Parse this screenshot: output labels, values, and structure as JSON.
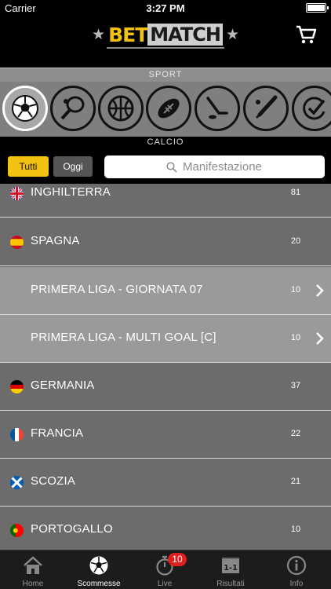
{
  "status_bar": {
    "carrier": "Carrier",
    "time": "3:27 PM"
  },
  "header": {
    "logo_bet": "BET",
    "logo_match": "MATCH",
    "cart_icon": "cart-icon"
  },
  "sport_bar": {
    "label": "SPORT",
    "selected_label": "CALCIO"
  },
  "sport_icons": [
    "soccer-ball-icon",
    "tennis-icon",
    "basketball-icon",
    "american-football-icon",
    "hockey-icon",
    "baseball-icon",
    "other-sport-icon"
  ],
  "filters": {
    "all_label": "Tutti",
    "today_label": "Oggi",
    "search_placeholder": "Manifestazione"
  },
  "rows": [
    {
      "name": "INGHILTERRA",
      "count": "81",
      "flag": "uk"
    },
    {
      "name": "SPAGNA",
      "count": "20",
      "flag": "es"
    },
    {
      "name": "PRIMERA LIGA - GIORNATA 07",
      "count": "10",
      "sub": true
    },
    {
      "name": "PRIMERA LIGA - MULTI GOAL [C]",
      "count": "10",
      "sub": true
    },
    {
      "name": "GERMANIA",
      "count": "37",
      "flag": "de"
    },
    {
      "name": "FRANCIA",
      "count": "22",
      "flag": "fr"
    },
    {
      "name": "SCOZIA",
      "count": "21",
      "flag": "sco"
    },
    {
      "name": "PORTOGALLO",
      "count": "10",
      "flag": "pt"
    }
  ],
  "tabs": [
    {
      "label": "Home",
      "icon": "home-icon"
    },
    {
      "label": "Scommesse",
      "icon": "soccer-ball-icon",
      "active": true
    },
    {
      "label": "Live",
      "icon": "stopwatch-icon",
      "badge": "10"
    },
    {
      "label": "Risultati",
      "icon": "scoreboard-icon"
    },
    {
      "label": "Info",
      "icon": "info-icon"
    }
  ],
  "colors": {
    "accent": "#f2c112",
    "badge": "#e0201f",
    "row_bg": "#6c6c6c",
    "subrow_bg": "#9a9a9a"
  }
}
